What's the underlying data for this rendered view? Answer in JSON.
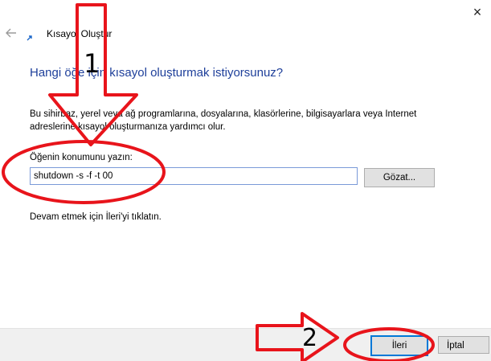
{
  "window": {
    "title": "Kısayol Oluştur",
    "close_glyph": "×",
    "back_icon": "back-arrow-icon",
    "app_icon": "shortcut-icon"
  },
  "wizard": {
    "main_instruction": "Hangi öğe için kısayol oluşturmak istiyorsunuz?",
    "description": "Bu sihirbaz, yerel veya ağ programlarına, dosyalarına, klasörlerine, bilgisayarlara veya Internet adreslerine kısayol oluşturmanıza yardımcı olur.",
    "location_label": "Öğenin konumunu yazın:",
    "location_value": "shutdown -s -f -t 00",
    "browse_label": "Gözat...",
    "hint": "Devam etmek için İleri'yi tıklatın."
  },
  "footer": {
    "next_label": "İleri",
    "cancel_label": "İptal"
  },
  "annotations": {
    "step1": "1",
    "step2": "2",
    "color": "#e8141b"
  },
  "colors": {
    "instruction_blue": "#1e3f9a",
    "focus_blue": "#0078d7",
    "footer_bg": "#f0f0f0"
  }
}
